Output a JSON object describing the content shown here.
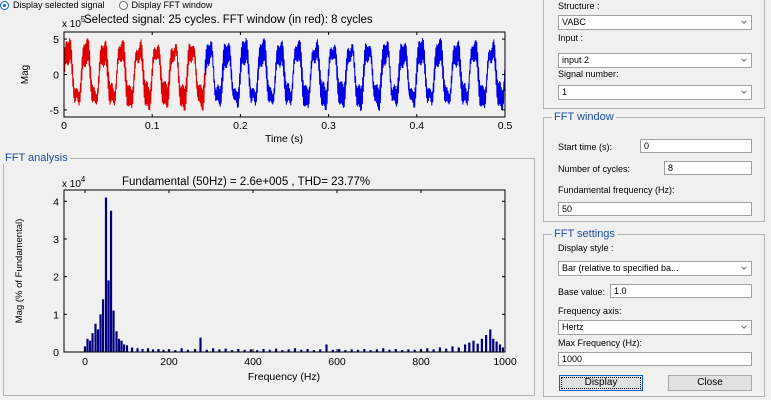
{
  "display_options": {
    "selected_signal_label": "Display selected signal",
    "fft_window_label": "Display FFT window",
    "selected": "selected_signal"
  },
  "right_panel": {
    "structure_label": "Structure :",
    "structure_value": "VABC",
    "input_label": "Input :",
    "input_value": "input 2",
    "signal_number_label": "Signal number:",
    "signal_number_value": "1"
  },
  "fft_window": {
    "title": "FFT window",
    "start_time_label": "Start time (s):",
    "start_time_value": "0",
    "num_cycles_label": "Number of cycles:",
    "num_cycles_value": "8",
    "fund_freq_label": "Fundamental frequency (Hz):",
    "fund_freq_value": "50"
  },
  "fft_settings": {
    "title": "FFT settings",
    "display_style_label": "Display style :",
    "display_style_value": "Bar (relative to specified ba...",
    "base_value_label": "Base value:",
    "base_value": "1.0",
    "freq_axis_label": "Frequency axis:",
    "freq_axis_value": "Hertz",
    "max_freq_label": "Max Frequency (Hz):",
    "max_freq_value": "1000",
    "display_button": "Display",
    "close_button": "Close"
  },
  "fft_analysis_title": "FFT analysis",
  "colors": {
    "window": "#e10000",
    "signal": "#0000e6",
    "bars": "#00007f",
    "panel_title": "#1e4fa0"
  },
  "chart_data": [
    {
      "type": "line",
      "title": "Selected signal: 25 cycles. FFT window (in red): 8 cycles",
      "xlabel": "Time (s)",
      "ylabel": "Mag",
      "exponent_label": "x 10",
      "exponent": "5",
      "xlim": [
        0,
        0.5
      ],
      "ylim": [
        -6,
        6
      ],
      "xticks": [
        "0",
        "0.1",
        "0.2",
        "0.3",
        "0.4",
        "0.5"
      ],
      "yticks": [
        "5",
        "0",
        "-5"
      ],
      "fundamental_hz": 50,
      "cycles": 25,
      "fft_window_end": 0.16,
      "series": [
        {
          "role": "fft-window",
          "x_range": [
            0,
            0.16
          ],
          "amplitude": 5.2
        },
        {
          "role": "signal",
          "x_range": [
            0.16,
            0.5
          ],
          "amplitude": 5.2
        }
      ]
    },
    {
      "type": "bar",
      "title": "Fundamental (50Hz) = 2.6e+005 , THD= 23.77%",
      "xlabel": "Frequency (Hz)",
      "ylabel": "Mag (% of Fundamental)",
      "exponent_label": "x 10",
      "exponent": "4",
      "xlim": [
        -50,
        1000
      ],
      "ylim": [
        0,
        4.3
      ],
      "xticks": [
        "0",
        "200",
        "400",
        "600",
        "800",
        "1000"
      ],
      "yticks": [
        "4",
        "3",
        "2",
        "1",
        "0"
      ],
      "bars": [
        {
          "f": 0,
          "v": 0.15
        },
        {
          "f": 6,
          "v": 0.35
        },
        {
          "f": 12,
          "v": 0.3
        },
        {
          "f": 18,
          "v": 0.5
        },
        {
          "f": 25,
          "v": 0.75
        },
        {
          "f": 31,
          "v": 0.6
        },
        {
          "f": 37,
          "v": 1.0
        },
        {
          "f": 43,
          "v": 1.4
        },
        {
          "f": 50,
          "v": 4.1
        },
        {
          "f": 56,
          "v": 1.9
        },
        {
          "f": 62,
          "v": 3.75
        },
        {
          "f": 68,
          "v": 1.1
        },
        {
          "f": 75,
          "v": 0.55
        },
        {
          "f": 81,
          "v": 0.35
        },
        {
          "f": 87,
          "v": 0.3
        },
        {
          "f": 93,
          "v": 0.2
        },
        {
          "f": 100,
          "v": 0.18
        },
        {
          "f": 112,
          "v": 0.12
        },
        {
          "f": 125,
          "v": 0.1
        },
        {
          "f": 137,
          "v": 0.08
        },
        {
          "f": 150,
          "v": 0.1
        },
        {
          "f": 162,
          "v": 0.07
        },
        {
          "f": 175,
          "v": 0.08
        },
        {
          "f": 187,
          "v": 0.06
        },
        {
          "f": 200,
          "v": 0.07
        },
        {
          "f": 215,
          "v": 0.05
        },
        {
          "f": 230,
          "v": 0.1
        },
        {
          "f": 245,
          "v": 0.06
        },
        {
          "f": 262,
          "v": 0.08
        },
        {
          "f": 275,
          "v": 0.38
        },
        {
          "f": 290,
          "v": 0.06
        },
        {
          "f": 305,
          "v": 0.1
        },
        {
          "f": 320,
          "v": 0.07
        },
        {
          "f": 335,
          "v": 0.09
        },
        {
          "f": 350,
          "v": 0.05
        },
        {
          "f": 365,
          "v": 0.08
        },
        {
          "f": 380,
          "v": 0.06
        },
        {
          "f": 395,
          "v": 0.07
        },
        {
          "f": 410,
          "v": 0.05
        },
        {
          "f": 425,
          "v": 0.08
        },
        {
          "f": 440,
          "v": 0.06
        },
        {
          "f": 455,
          "v": 0.09
        },
        {
          "f": 470,
          "v": 0.05
        },
        {
          "f": 485,
          "v": 0.07
        },
        {
          "f": 500,
          "v": 0.1
        },
        {
          "f": 515,
          "v": 0.06
        },
        {
          "f": 530,
          "v": 0.08
        },
        {
          "f": 545,
          "v": 0.05
        },
        {
          "f": 560,
          "v": 0.07
        },
        {
          "f": 575,
          "v": 0.2
        },
        {
          "f": 590,
          "v": 0.06
        },
        {
          "f": 605,
          "v": 0.08
        },
        {
          "f": 620,
          "v": 0.05
        },
        {
          "f": 635,
          "v": 0.07
        },
        {
          "f": 650,
          "v": 0.06
        },
        {
          "f": 665,
          "v": 0.08
        },
        {
          "f": 680,
          "v": 0.05
        },
        {
          "f": 695,
          "v": 0.07
        },
        {
          "f": 710,
          "v": 0.1
        },
        {
          "f": 725,
          "v": 0.06
        },
        {
          "f": 740,
          "v": 0.08
        },
        {
          "f": 755,
          "v": 0.05
        },
        {
          "f": 770,
          "v": 0.07
        },
        {
          "f": 785,
          "v": 0.06
        },
        {
          "f": 800,
          "v": 0.08
        },
        {
          "f": 815,
          "v": 0.1
        },
        {
          "f": 830,
          "v": 0.07
        },
        {
          "f": 845,
          "v": 0.12
        },
        {
          "f": 860,
          "v": 0.09
        },
        {
          "f": 875,
          "v": 0.15
        },
        {
          "f": 890,
          "v": 0.12
        },
        {
          "f": 905,
          "v": 0.2
        },
        {
          "f": 915,
          "v": 0.25
        },
        {
          "f": 925,
          "v": 0.3
        },
        {
          "f": 935,
          "v": 0.22
        },
        {
          "f": 945,
          "v": 0.35
        },
        {
          "f": 955,
          "v": 0.45
        },
        {
          "f": 965,
          "v": 0.6
        },
        {
          "f": 972,
          "v": 0.35
        },
        {
          "f": 980,
          "v": 0.28
        },
        {
          "f": 988,
          "v": 0.2
        },
        {
          "f": 995,
          "v": 0.12
        }
      ]
    }
  ]
}
